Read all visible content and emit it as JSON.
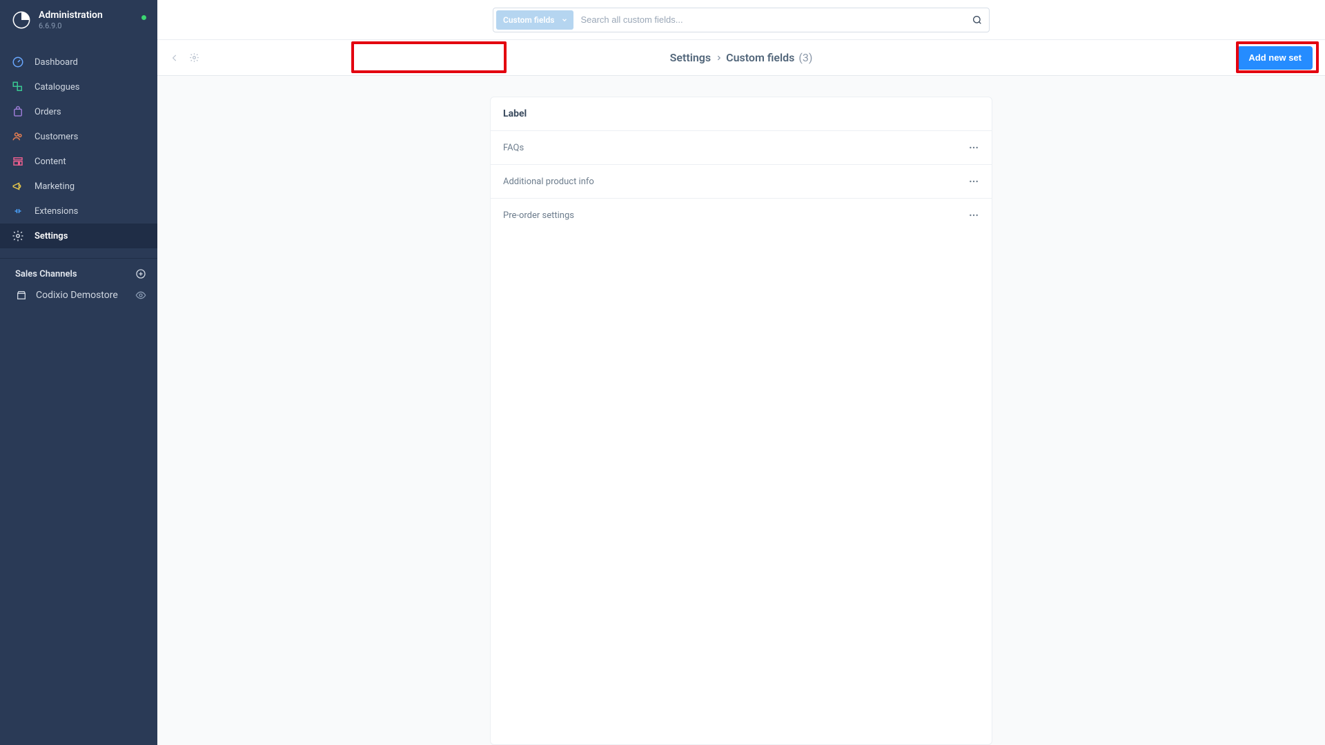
{
  "app": {
    "title": "Administration",
    "version": "6.6.9.0"
  },
  "sidebar": {
    "nav": [
      {
        "key": "dashboard",
        "label": "Dashboard"
      },
      {
        "key": "catalogues",
        "label": "Catalogues"
      },
      {
        "key": "orders",
        "label": "Orders"
      },
      {
        "key": "customers",
        "label": "Customers"
      },
      {
        "key": "content",
        "label": "Content"
      },
      {
        "key": "marketing",
        "label": "Marketing"
      },
      {
        "key": "extensions",
        "label": "Extensions"
      },
      {
        "key": "settings",
        "label": "Settings"
      }
    ],
    "sales_channels_label": "Sales Channels",
    "channels": [
      {
        "label": "Codixio Demostore"
      }
    ]
  },
  "search": {
    "pill_label": "Custom fields",
    "placeholder": "Search all custom fields..."
  },
  "breadcrumb": {
    "root": "Settings",
    "leaf": "Custom fields",
    "count": "(3)"
  },
  "actions": {
    "add_button": "Add new set"
  },
  "table": {
    "header": "Label",
    "rows": [
      {
        "label": "FAQs"
      },
      {
        "label": "Additional product info"
      },
      {
        "label": "Pre-order settings"
      }
    ]
  },
  "colors": {
    "sidebar_bg": "#2a3a56",
    "accent": "#258cff",
    "annotation": "#e3000f"
  }
}
